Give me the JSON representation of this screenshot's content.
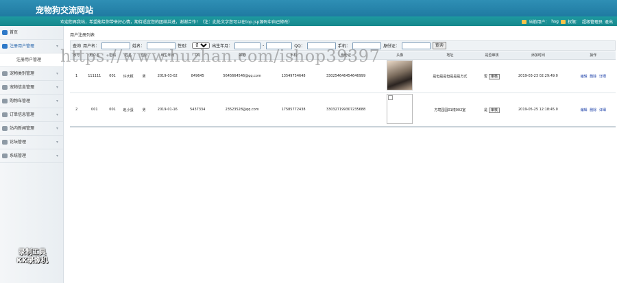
{
  "header": {
    "site_title": "宠物狗交流网站",
    "welcome": "欢迎您再我站，希望能给你带来好心情，期待适宜您的团结共进，谢谢合作！（注：此处文字您可以在top.jsp源码中自己修改）",
    "current_user_label": "当前用户：",
    "current_user": "hsg",
    "role_label": "权限：",
    "role": "超级管理员",
    "logout": "退出"
  },
  "sidebar": {
    "items": [
      {
        "label": "首页",
        "icon": "home-icon"
      },
      {
        "label": "注册用户管理",
        "icon": "grid-icon",
        "expanded": true
      },
      {
        "label": "注册用户管理",
        "sub": true
      },
      {
        "label": "宠物类别管理",
        "icon": "home-icon"
      },
      {
        "label": "宠物信息管理",
        "icon": "users-icon"
      },
      {
        "label": "购物车管理",
        "icon": "user-icon"
      },
      {
        "label": "订单信息管理",
        "icon": "cart-icon"
      },
      {
        "label": "站内新闻管理",
        "icon": "heart-icon"
      },
      {
        "label": "论坛管理",
        "icon": "folder-icon"
      },
      {
        "label": "系统管理",
        "icon": "gear-icon"
      }
    ]
  },
  "breadcrumb": "用户注册列表",
  "search": {
    "query_label": "查询",
    "username_label": "用户名：",
    "name_label": "姓名：",
    "gender_label": "性别：",
    "gender_value": "请选择",
    "birth_label": "出生年月：",
    "qq_label": "QQ：",
    "phone_label": "手机：",
    "idcard_label": "身份证：",
    "button": "查询"
  },
  "table": {
    "headers": [
      "序号",
      "用户名",
      "密码",
      "姓名",
      "性别",
      "出生年月",
      "QQ",
      "邮箱",
      "手机",
      "身份证",
      "头像",
      "地址",
      "是否审核",
      "添加时间",
      "操作"
    ],
    "rows": [
      {
        "no": "1",
        "username": "111111",
        "password": "001",
        "name": "许大柜",
        "gender": "男",
        "birth": "2019-03-02",
        "qq": "849645",
        "email": "5645664546@qq.com",
        "phone": "13549754648",
        "idcard": "330254646454646999",
        "address": "是但是是但是是是方式",
        "audit": "否",
        "audit_btn": "审核",
        "time": "2019-03-23 02:29:49.0",
        "ops": [
          "编辑",
          "删除",
          "详细"
        ]
      },
      {
        "no": "2",
        "username": "001",
        "password": "001",
        "name": "赵小蛋",
        "gender": "男",
        "birth": "2019-01-16",
        "qq": "5437334",
        "email": "23523528@qq.com",
        "phone": "17585772438",
        "idcard": "330327199307235688",
        "address": "方境园园01幢002室",
        "audit": "是",
        "audit_btn": "审核",
        "time": "2019-05-25 12:18:45.0",
        "ops": [
          "编辑",
          "删除",
          "详细"
        ]
      }
    ]
  },
  "watermark": "https://www.huzhan.com/ishop39397",
  "badge": [
    "录制工具",
    "KK录像机"
  ]
}
